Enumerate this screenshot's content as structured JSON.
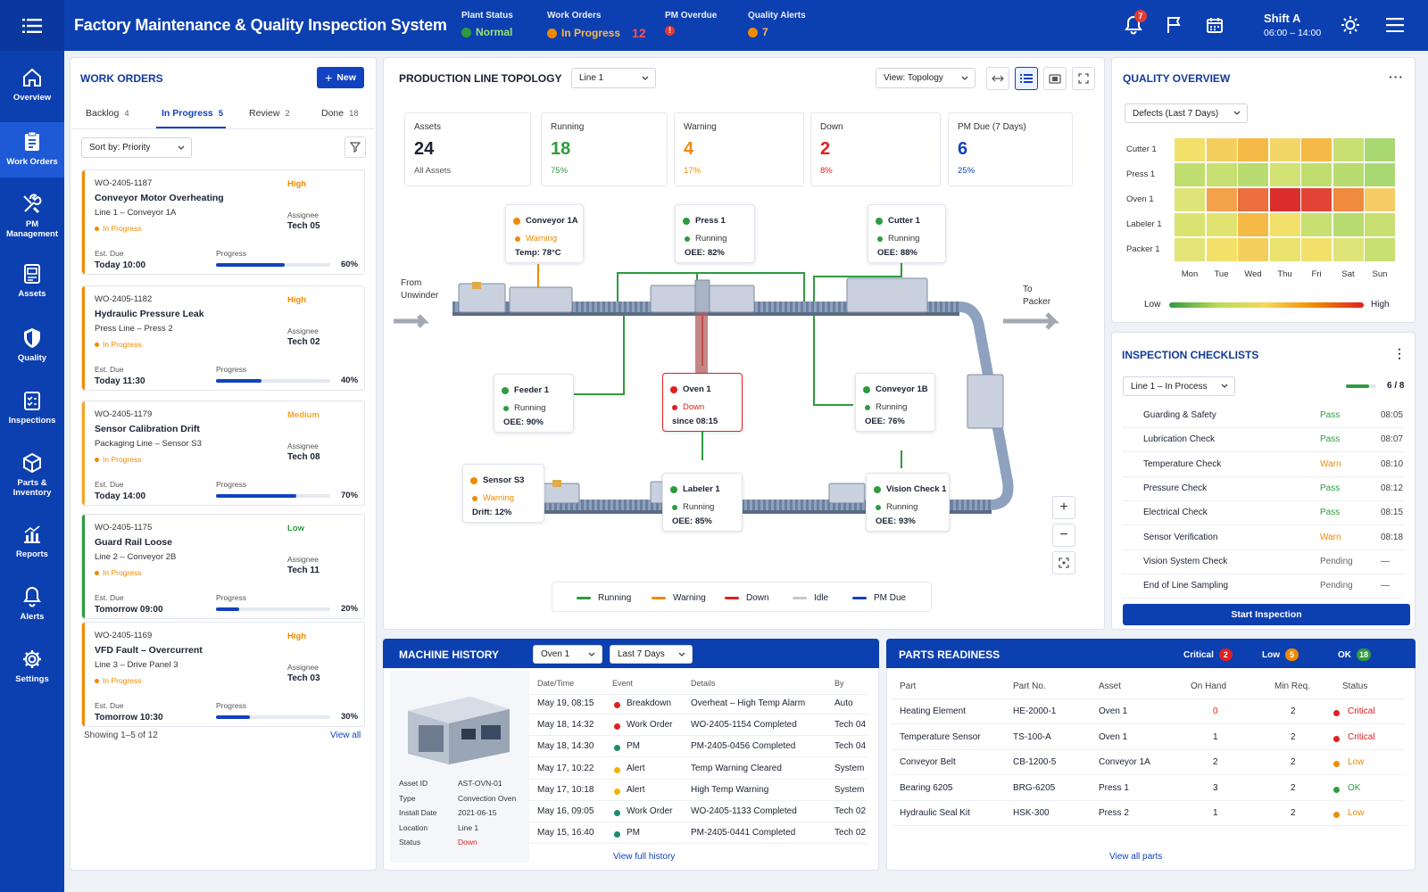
{
  "header": {
    "title": "Factory Maintenance & Quality Inspection System",
    "plant_status": {
      "label": "Plant Status",
      "value": "Normal"
    },
    "work_orders": {
      "label": "Work Orders",
      "value": "In Progress",
      "count": "12"
    },
    "pm_overdue": {
      "label": "PM Overdue",
      "value": "!"
    },
    "quality_alerts": {
      "label": "Quality Alerts",
      "value": "7"
    },
    "notifications_count": "7",
    "shift": {
      "name": "Shift A",
      "time": "06:00 – 14:00"
    }
  },
  "sidebar": {
    "items": [
      {
        "label": "Overview",
        "icon": "home-icon"
      },
      {
        "label": "Work Orders",
        "icon": "clipboard-icon"
      },
      {
        "label": "PM\nManagement",
        "icon": "tools-icon"
      },
      {
        "label": "Assets",
        "icon": "assets-icon"
      },
      {
        "label": "Quality",
        "icon": "shield-icon"
      },
      {
        "label": "Inspections",
        "icon": "checklist-icon"
      },
      {
        "label": "Parts &\nInventory",
        "icon": "cube-icon"
      },
      {
        "label": "Reports",
        "icon": "chart-icon"
      },
      {
        "label": "Alerts",
        "icon": "bell-icon"
      },
      {
        "label": "Settings",
        "icon": "gear-icon"
      }
    ]
  },
  "work_orders": {
    "title": "WORK ORDERS",
    "new_label": "New",
    "tabs": [
      {
        "label": "Backlog",
        "count": "4"
      },
      {
        "label": "In Progress",
        "count": "5"
      },
      {
        "label": "Review",
        "count": "2"
      },
      {
        "label": "Done",
        "count": "18"
      }
    ],
    "sort_label": "Sort by: Priority",
    "labels": {
      "assignee": "Assignee",
      "est_due": "Est. Due",
      "progress": "Progress"
    },
    "cards": [
      {
        "id": "WO-2405-1187",
        "priority": "High",
        "title": "Conveyor Motor Overheating",
        "location": "Line 1 – Conveyor 1A",
        "status": "In Progress",
        "assignee": "Tech 05",
        "due": "Today 10:00",
        "progress": 60,
        "progress_label": "60%"
      },
      {
        "id": "WO-2405-1182",
        "priority": "High",
        "title": "Hydraulic Pressure Leak",
        "location": "Press Line – Press 2",
        "status": "In Progress",
        "assignee": "Tech 02",
        "due": "Today 11:30",
        "progress": 40,
        "progress_label": "40%"
      },
      {
        "id": "WO-2405-1179",
        "priority": "Medium",
        "title": "Sensor Calibration Drift",
        "location": "Packaging Line – Sensor S3",
        "status": "In Progress",
        "assignee": "Tech 08",
        "due": "Today 14:00",
        "progress": 70,
        "progress_label": "70%"
      },
      {
        "id": "WO-2405-1175",
        "priority": "Low",
        "title": "Guard Rail Loose",
        "location": "Line 2 – Conveyor 2B",
        "status": "In Progress",
        "assignee": "Tech 11",
        "due": "Tomorrow 09:00",
        "progress": 20,
        "progress_label": "20%"
      },
      {
        "id": "WO-2405-1169",
        "priority": "High",
        "title": "VFD Fault – Overcurrent",
        "location": "Line 3 – Drive Panel 3",
        "status": "In Progress",
        "assignee": "Tech 03",
        "due": "Tomorrow 10:30",
        "progress": 30,
        "progress_label": "30%"
      }
    ],
    "showing": "Showing 1–5 of 12",
    "view_all": "View all"
  },
  "topology": {
    "title": "PRODUCTION LINE TOPOLOGY",
    "line_select": "Line 1",
    "view_select": "View: Topology",
    "stats": [
      {
        "label": "Assets",
        "value": "24",
        "sub": "All Assets",
        "color": "#1b2233"
      },
      {
        "label": "Running",
        "value": "18",
        "sub": "75%",
        "color": "#2e9b3e"
      },
      {
        "label": "Warning",
        "value": "4",
        "sub": "17%",
        "color": "#f08a00"
      },
      {
        "label": "Down",
        "value": "2",
        "sub": "8%",
        "color": "#e02020"
      },
      {
        "label": "PM Due (7 Days)",
        "value": "6",
        "sub": "25%",
        "color": "#1142c0"
      }
    ],
    "from_label": "From\nUnwinder",
    "to_label": "To\nPacker",
    "machines": [
      {
        "name": "Conveyor 1A",
        "status": "Warning",
        "metric": "Temp: 78°C"
      },
      {
        "name": "Press 1",
        "status": "Running",
        "metric": "OEE: 82%"
      },
      {
        "name": "Cutter 1",
        "status": "Running",
        "metric": "OEE: 88%"
      },
      {
        "name": "Feeder 1",
        "status": "Running",
        "metric": "OEE: 90%"
      },
      {
        "name": "Oven 1",
        "status": "Down",
        "metric": "since 08:15"
      },
      {
        "name": "Conveyor 1B",
        "status": "Running",
        "metric": "OEE: 76%"
      },
      {
        "name": "Sensor S3",
        "status": "Warning",
        "metric": "Drift: 12%"
      },
      {
        "name": "Labeler 1",
        "status": "Running",
        "metric": "OEE: 85%"
      },
      {
        "name": "Vision Check 1",
        "status": "Running",
        "metric": "OEE: 93%"
      }
    ],
    "legend": [
      "Running",
      "Warning",
      "Down",
      "Idle",
      "PM Due"
    ],
    "colors": {
      "running": "#2e9b3e",
      "warning": "#f08a00",
      "down": "#e02020",
      "idle": "#c4c8d0",
      "pm_due": "#1142c0"
    }
  },
  "quality": {
    "title": "QUALITY OVERVIEW",
    "select": "Defects (Last 7 Days)",
    "rows": [
      "Cutter 1",
      "Press 1",
      "Oven 1",
      "Labeler 1",
      "Packer 1"
    ],
    "days": [
      "Mon",
      "Tue",
      "Wed",
      "Thu",
      "Fri",
      "Sat",
      "Sun"
    ],
    "scale_low": "Low",
    "scale_high": "High",
    "heat_colors": [
      [
        "#f3e06a",
        "#f4cf5e",
        "#f5b945",
        "#f2d766",
        "#f5b945",
        "#c8df72",
        "#a9d873"
      ],
      [
        "#c0de6e",
        "#c8df72",
        "#b8dc6f",
        "#d3e274",
        "#c0de6e",
        "#b8dc6f",
        "#a9d873"
      ],
      [
        "#dfe478",
        "#f4a14c",
        "#ec6e3e",
        "#dc2d2d",
        "#e34436",
        "#f08a3e",
        "#f5cc66"
      ],
      [
        "#d9e36f",
        "#e0e36f",
        "#f5b945",
        "#f3e06a",
        "#c8df72",
        "#b8dc6f",
        "#c8df72"
      ],
      [
        "#e2e477",
        "#f3e06a",
        "#f4cf5e",
        "#e9e26d",
        "#f3e06a",
        "#dfe478",
        "#c8df72"
      ]
    ]
  },
  "inspection": {
    "title": "INSPECTION CHECKLISTS",
    "select": "Line 1 – In Process",
    "progress": "6 / 8",
    "items": [
      {
        "name": "Guarding & Safety",
        "result": "Pass",
        "time": "08:05",
        "state": "pass"
      },
      {
        "name": "Lubrication Check",
        "result": "Pass",
        "time": "08:07",
        "state": "pass"
      },
      {
        "name": "Temperature Check",
        "result": "Warn",
        "time": "08:10",
        "state": "warn"
      },
      {
        "name": "Pressure Check",
        "result": "Pass",
        "time": "08:12",
        "state": "pass"
      },
      {
        "name": "Electrical Check",
        "result": "Pass",
        "time": "08:15",
        "state": "pass"
      },
      {
        "name": "Sensor Verification",
        "result": "Warn",
        "time": "08:18",
        "state": "warn"
      },
      {
        "name": "Vision System Check",
        "result": "Pending",
        "time": "—",
        "state": "pending"
      },
      {
        "name": "End of Line Sampling",
        "result": "Pending",
        "time": "—",
        "state": "pending"
      }
    ],
    "start_label": "Start Inspection"
  },
  "machine_history": {
    "title": "MACHINE HISTORY",
    "machine_select": "Oven 1",
    "range_select": "Last 7 Days",
    "asset_fields": [
      {
        "k": "Asset ID",
        "v": "AST-OVN-01"
      },
      {
        "k": "Type",
        "v": "Convection Oven"
      },
      {
        "k": "Install Date",
        "v": "2021-06-15"
      },
      {
        "k": "Location",
        "v": "Line 1"
      },
      {
        "k": "Status",
        "v": "Down"
      }
    ],
    "columns": [
      "Date/Time",
      "Event",
      "Details",
      "By"
    ],
    "rows": [
      {
        "dt": "May 19, 08:15",
        "event": "Breakdown",
        "details": "Overheat – High Temp Alarm",
        "by": "Auto",
        "color": "#e02020"
      },
      {
        "dt": "May 18, 14:32",
        "event": "Work Order",
        "details": "WO-2405-1154 Completed",
        "by": "Tech 04",
        "color": "#e02020"
      },
      {
        "dt": "May 18, 14:30",
        "event": "PM",
        "details": "PM-2405-0456 Completed",
        "by": "Tech 04",
        "color": "#1e8a6e"
      },
      {
        "dt": "May 17, 10:22",
        "event": "Alert",
        "details": "Temp Warning Cleared",
        "by": "System",
        "color": "#f0b400"
      },
      {
        "dt": "May 17, 10:18",
        "event": "Alert",
        "details": "High Temp Warning",
        "by": "System",
        "color": "#f0b400"
      },
      {
        "dt": "May 16, 09:05",
        "event": "Work Order",
        "details": "WO-2405-1133 Completed",
        "by": "Tech 02",
        "color": "#1e8a6e"
      },
      {
        "dt": "May 15, 16:40",
        "event": "PM",
        "details": "PM-2405-0441 Completed",
        "by": "Tech 02",
        "color": "#1e8a6e"
      }
    ],
    "view_full": "View full history"
  },
  "parts": {
    "title": "PARTS READINESS",
    "summary": [
      {
        "label": "Critical",
        "count": "2",
        "color": "#e02020"
      },
      {
        "label": "Low",
        "count": "5",
        "color": "#f08a00"
      },
      {
        "label": "OK",
        "count": "18",
        "color": "#2e9b3e"
      }
    ],
    "columns": [
      "Part",
      "Part No.",
      "Asset",
      "On Hand",
      "Min Req.",
      "Status"
    ],
    "rows": [
      {
        "part": "Heating Element",
        "no": "HE-2000-1",
        "asset": "Oven 1",
        "on_hand": "0",
        "min": "2",
        "status": "Critical",
        "color": "#e02020"
      },
      {
        "part": "Temperature Sensor",
        "no": "TS-100-A",
        "asset": "Oven 1",
        "on_hand": "1",
        "min": "2",
        "status": "Critical",
        "color": "#e02020"
      },
      {
        "part": "Conveyor Belt",
        "no": "CB-1200-5",
        "asset": "Conveyor 1A",
        "on_hand": "2",
        "min": "2",
        "status": "Low",
        "color": "#f08a00"
      },
      {
        "part": "Bearing 6205",
        "no": "BRG-6205",
        "asset": "Press 1",
        "on_hand": "3",
        "min": "2",
        "status": "OK",
        "color": "#2e9b3e"
      },
      {
        "part": "Hydraulic Seal Kit",
        "no": "HSK-300",
        "asset": "Press 2",
        "on_hand": "1",
        "min": "2",
        "status": "Low",
        "color": "#f08a00"
      }
    ],
    "view_all": "View all parts"
  }
}
